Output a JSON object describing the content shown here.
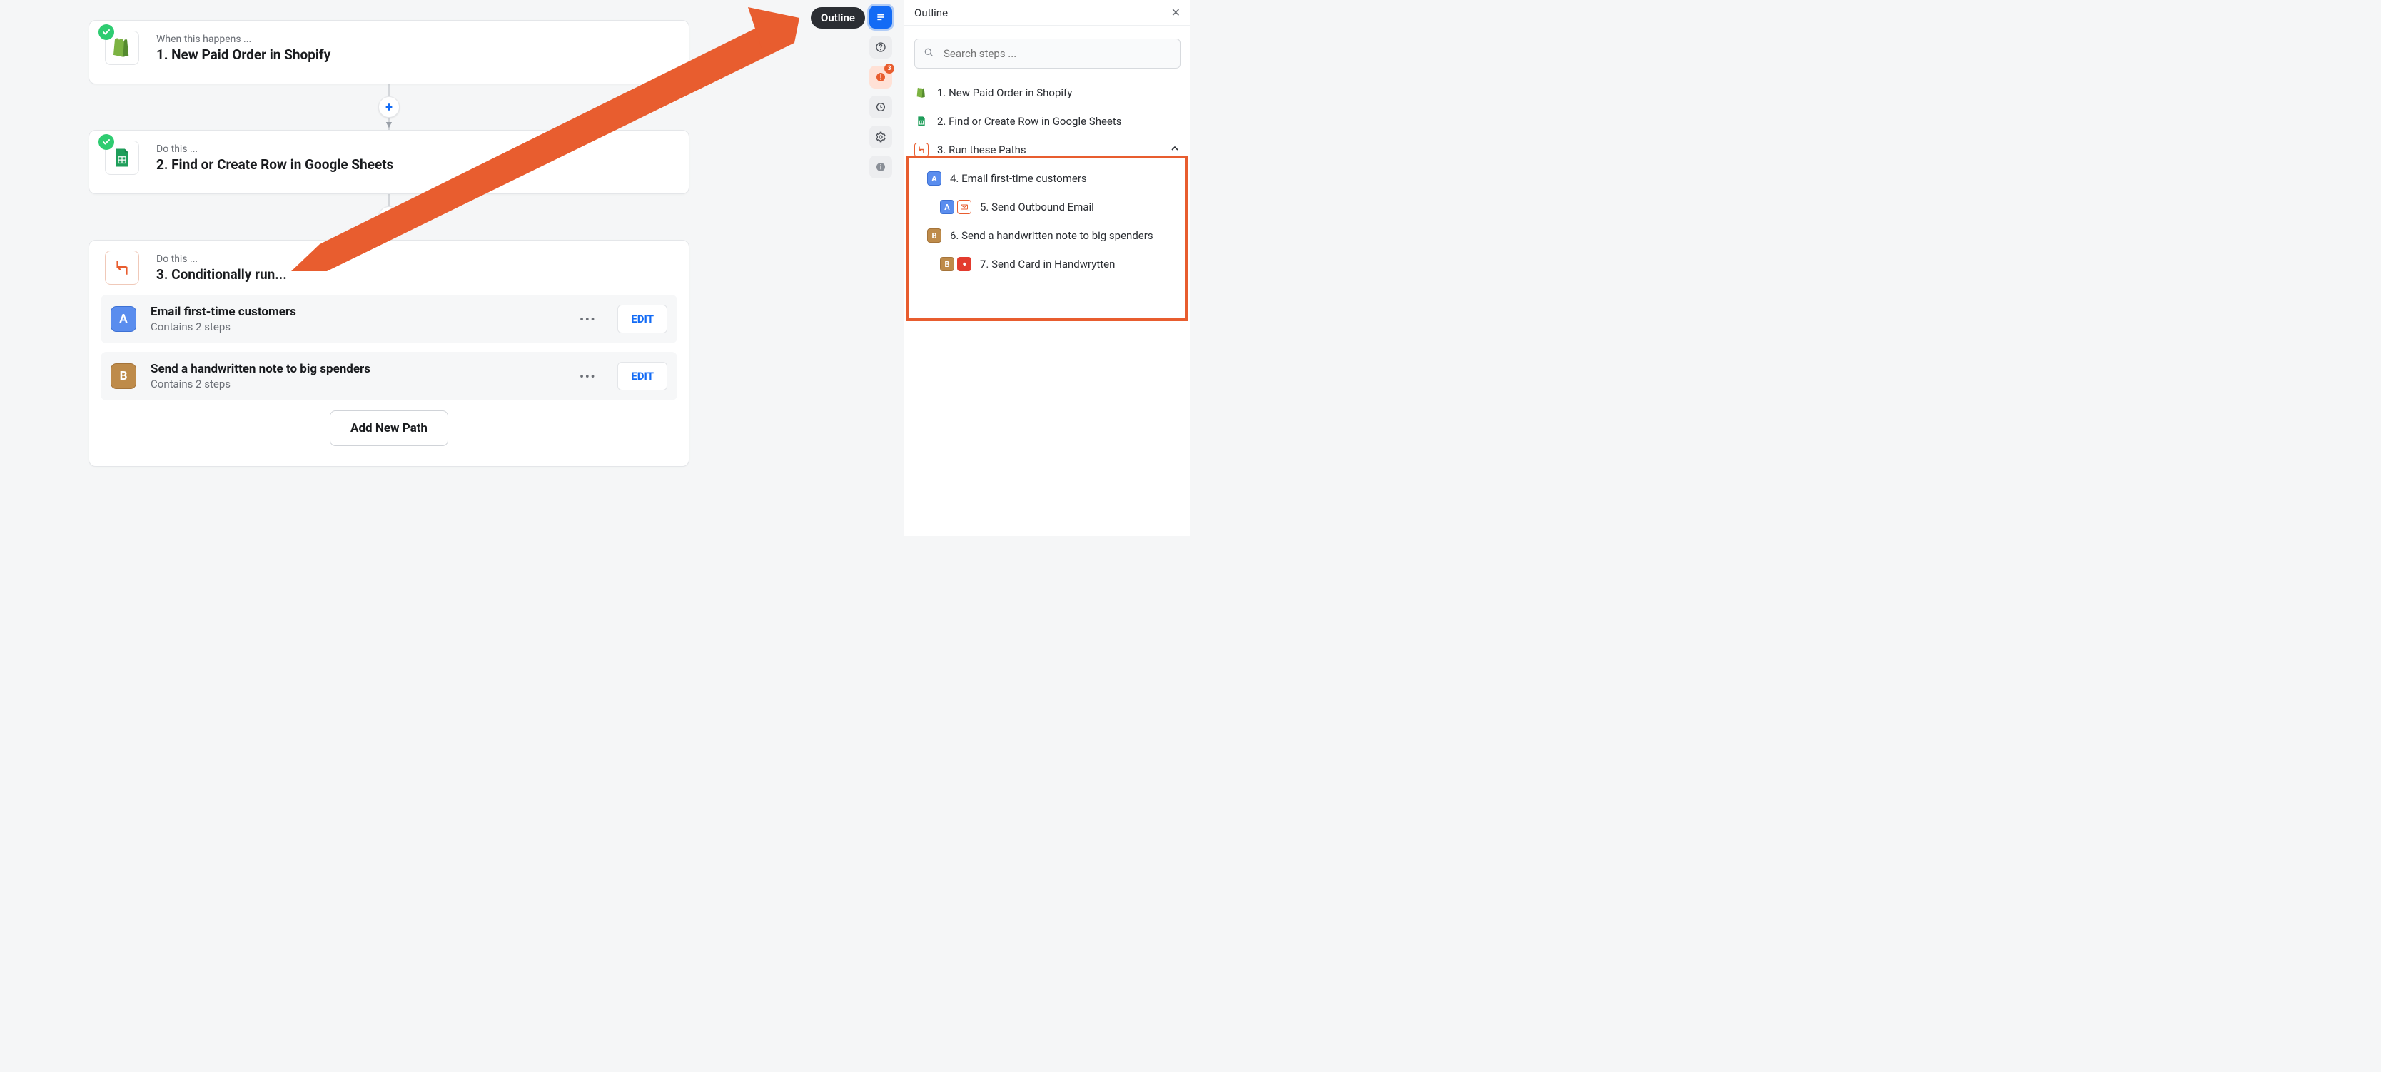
{
  "tooltip": {
    "outline": "Outline"
  },
  "toolbar": {
    "warn_badge": "3"
  },
  "canvas": {
    "trigger": {
      "eyebrow": "When this happens ...",
      "title": "1. New Paid Order in Shopify"
    },
    "action1": {
      "eyebrow": "Do this ...",
      "title": "2. Find or Create Row in Google Sheets"
    },
    "action2": {
      "eyebrow": "Do this ...",
      "title": "3. Conditionally run..."
    },
    "paths": [
      {
        "letter": "A",
        "color": "blue",
        "title": "Email first-time customers",
        "sub": "Contains 2 steps",
        "edit": "EDIT"
      },
      {
        "letter": "B",
        "color": "brown",
        "title": "Send a handwritten note to big spenders",
        "sub": "Contains 2 steps",
        "edit": "EDIT"
      }
    ],
    "add_path": "Add New Path"
  },
  "outline": {
    "header": "Outline",
    "search_placeholder": "Search steps ...",
    "items": {
      "i1": "1. New Paid Order in Shopify",
      "i2": "2. Find or Create Row in Google Sheets",
      "i3": "3. Run these Paths",
      "i4": "4. Email first-time customers",
      "i5": "5. Send Outbound Email",
      "i6": "6. Send a handwritten note to big spenders",
      "i7": "7. Send Card in Handwrytten"
    }
  }
}
